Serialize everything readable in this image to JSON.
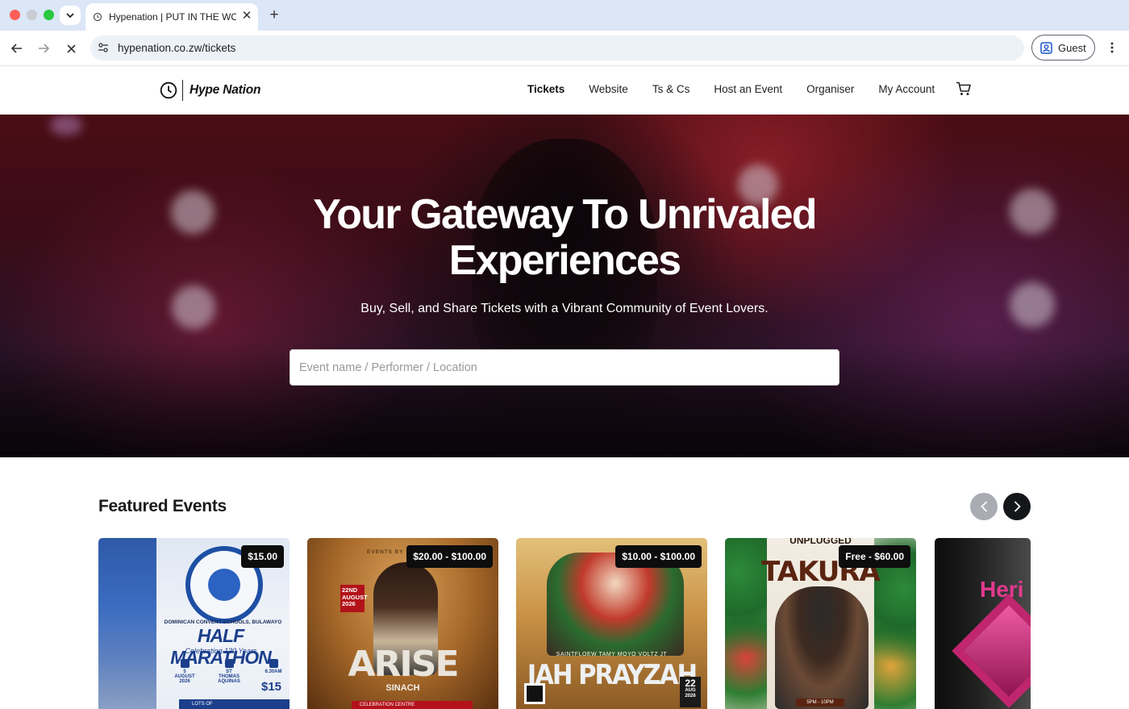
{
  "browser": {
    "tab_title": "Hypenation | PUT IN THE WORK",
    "url_host": "hypenation.co.zw",
    "url_path": "/tickets",
    "profile_label": "Guest"
  },
  "site": {
    "logo_text": "Hype Nation",
    "nav": [
      {
        "label": "Tickets",
        "active": true
      },
      {
        "label": "Website",
        "active": false
      },
      {
        "label": "Ts & Cs",
        "active": false
      },
      {
        "label": "Host an Event",
        "active": false
      },
      {
        "label": "Organiser",
        "active": false
      },
      {
        "label": "My Account",
        "active": false
      }
    ]
  },
  "hero": {
    "title_line1": "Your Gateway To Unrivaled",
    "title_line2": "Experiences",
    "subtitle": "Buy, Sell, and Share Tickets with a Vibrant Community of Event Lovers.",
    "search_placeholder": "Event name / Performer / Location"
  },
  "featured": {
    "title": "Featured Events",
    "events": [
      {
        "price": "$15.00",
        "poster": {
          "school": "DOMINICAN CONVENT SCHOOLS, BULAWAYO",
          "title": "HALF MARATHON",
          "tagline": "Celebrating 130 Years",
          "date": "5 AUGUST 2026",
          "venue": "ST THOMAS AQUINAS",
          "time": "6.30AM",
          "cost": "$15",
          "footer": "LOTS OF"
        }
      },
      {
        "price": "$20.00 - $100.00",
        "poster": {
          "events_by": "EVENTS BY",
          "date": "22ND AUGUST 2026",
          "title": "ARISE",
          "artist": "SINACH",
          "venue": "CELEBRATION CENTRE"
        }
      },
      {
        "price": "$10.00 - $100.00",
        "poster": {
          "artists": "SAINTFLOEW   TAMY MOYO   VOLTZ JT",
          "title": "JAH PRAYZAH",
          "date_day": "22",
          "date_month": "AUG 2026"
        }
      },
      {
        "price": "Free - $60.00",
        "poster": {
          "series": "UNPLUGGED",
          "title": "TAKURA",
          "time": "5PM - 10PM"
        }
      },
      {
        "price": "",
        "poster": {
          "title": "Heri"
        }
      }
    ]
  },
  "colors": {
    "tabbar": "#dbe6f7",
    "carousel_prev": "#a9acb2",
    "carousel_next": "#14161a",
    "badge": "#0d0d0d"
  }
}
